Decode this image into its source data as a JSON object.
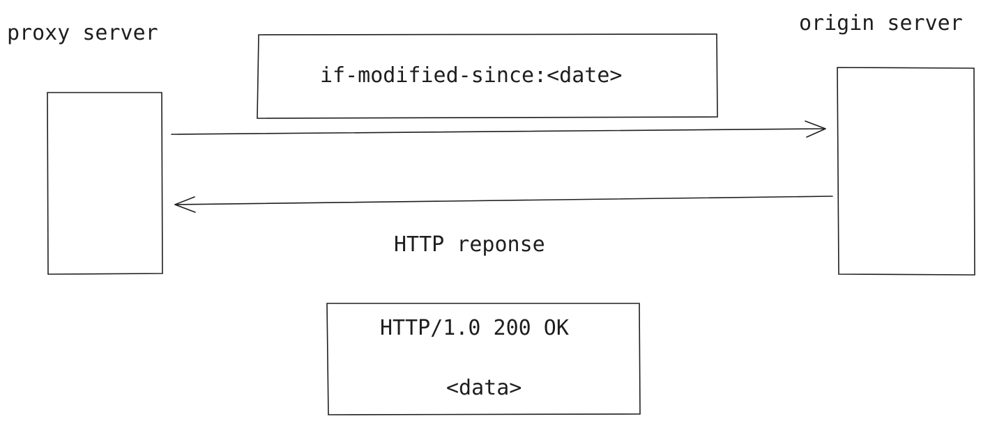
{
  "proxy": {
    "label": "proxy server"
  },
  "origin": {
    "label": "origin server"
  },
  "request": {
    "header": "if-modified-since:<date>"
  },
  "response": {
    "label": "HTTP reponse",
    "status": "HTTP/1.0 200 OK",
    "body": "<data>"
  }
}
